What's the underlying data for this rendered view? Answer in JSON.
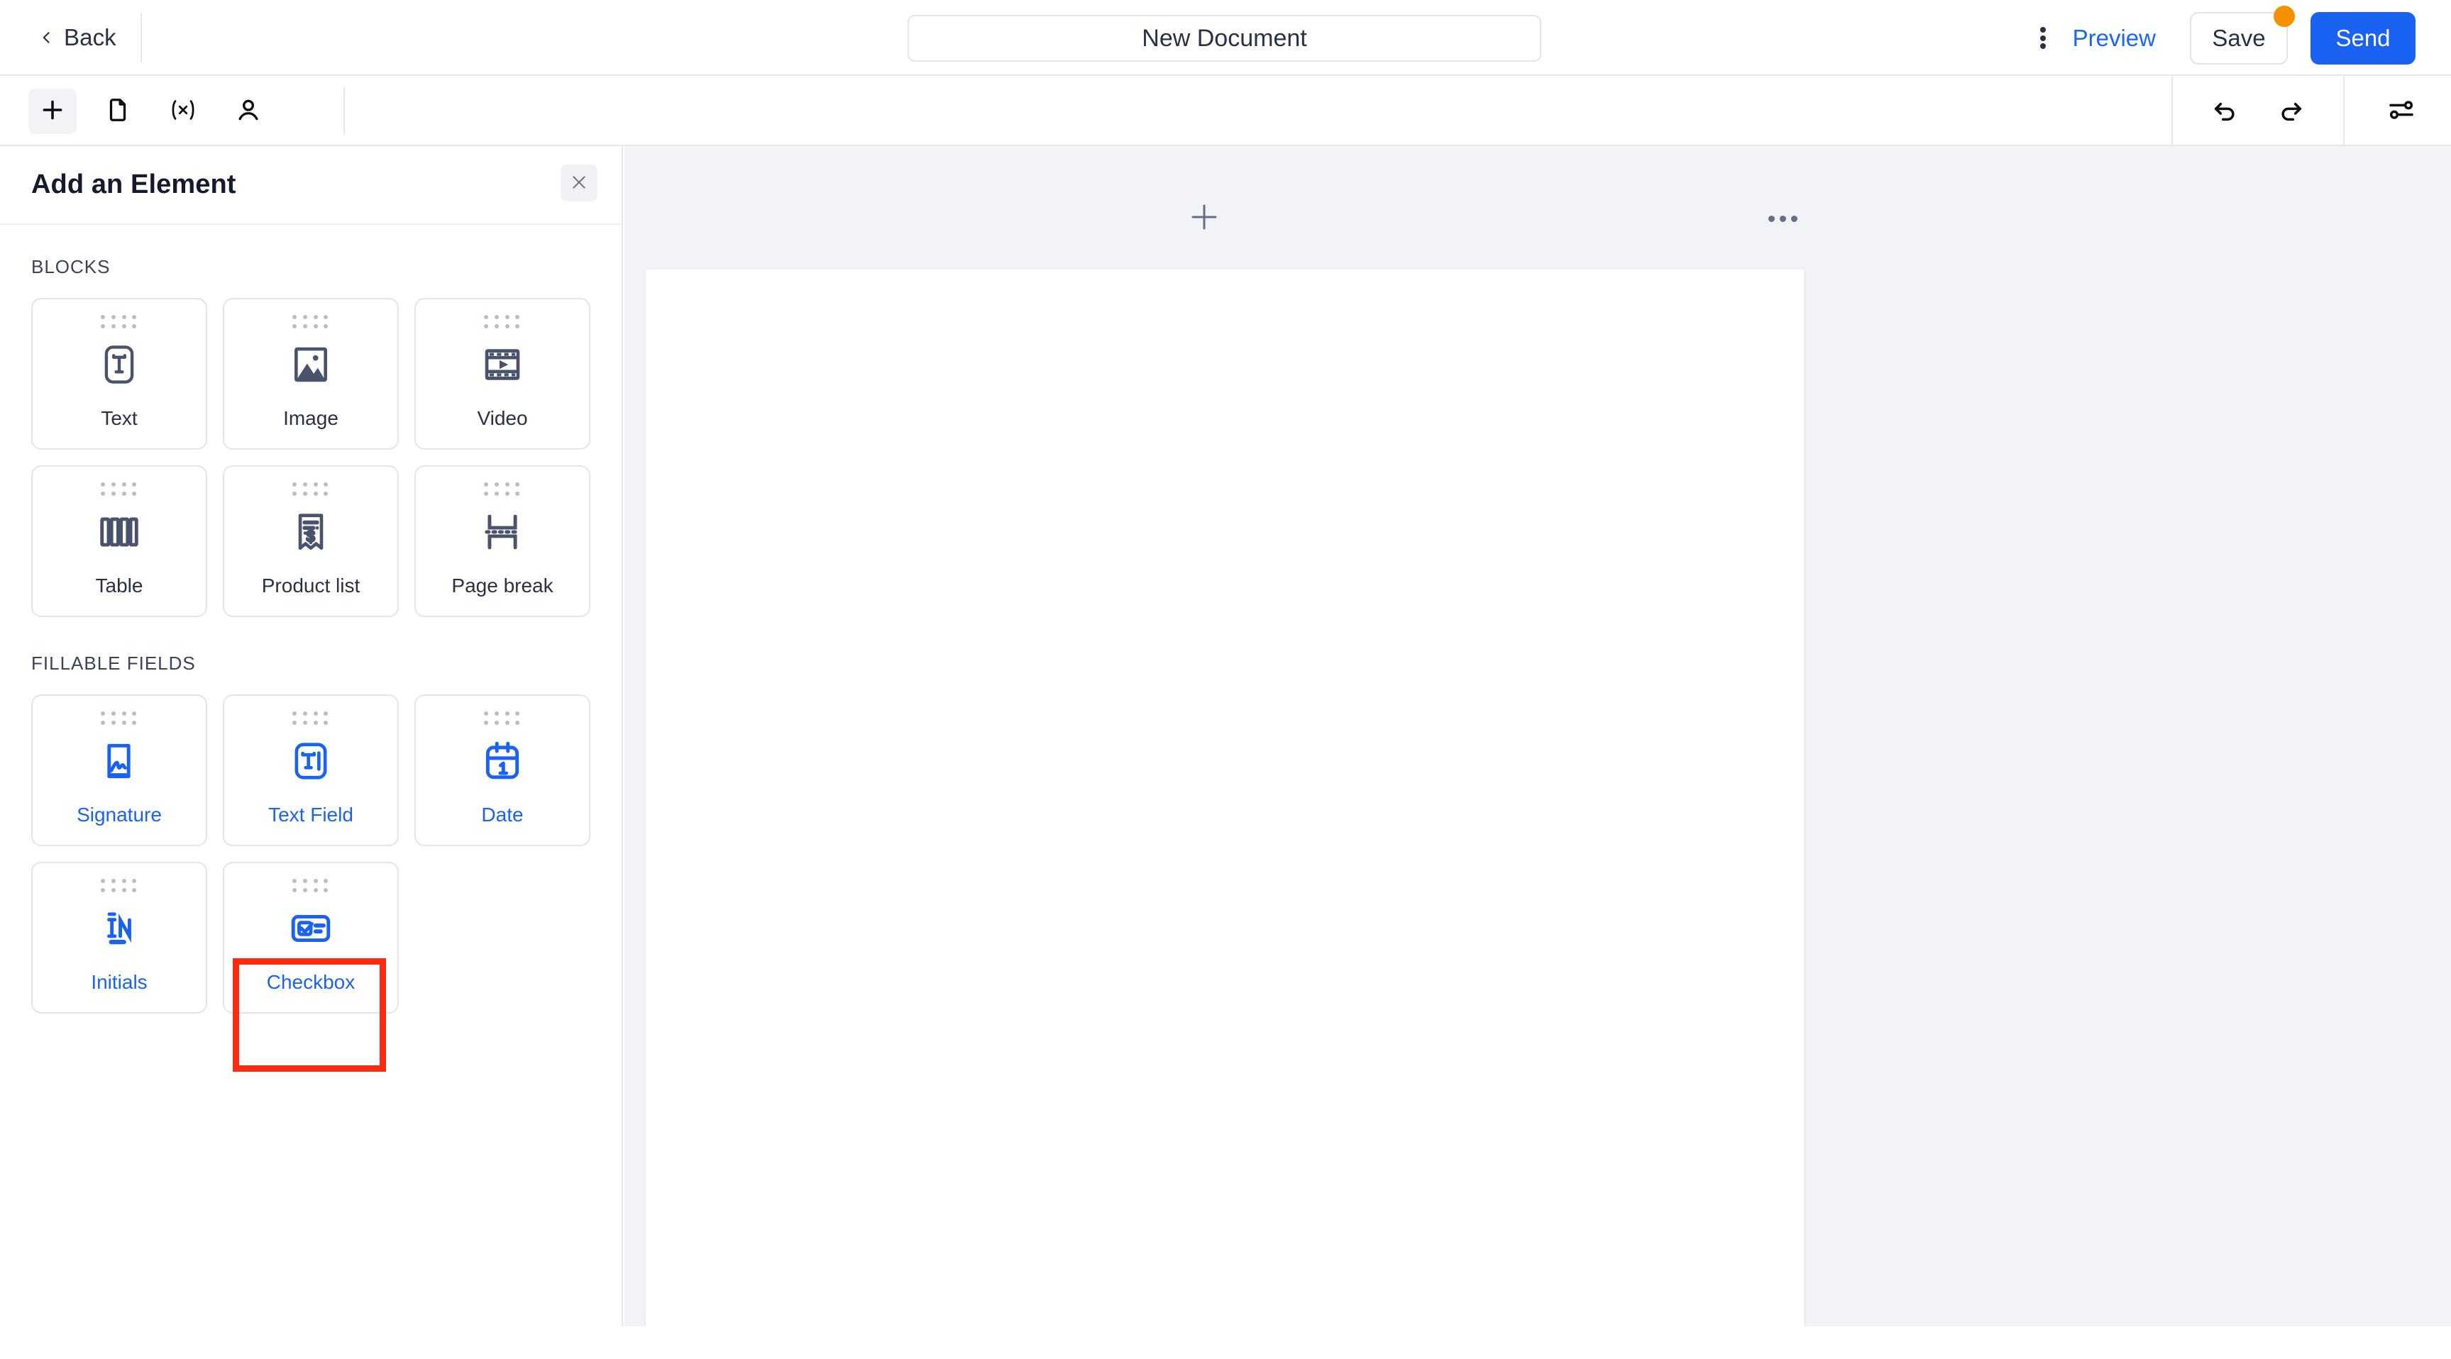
{
  "header": {
    "back_label": "Back",
    "back_icon": "chevron-left-icon",
    "document_title": "New Document",
    "document_title_placeholder": "Document name",
    "kebab_icon": "more-vertical-icon",
    "preview_label": "Preview",
    "save_label": "Save",
    "save_badge_color": "#f59100",
    "send_label": "Send",
    "send_color": "#1a63f2"
  },
  "toolbar": {
    "left_tools": [
      {
        "name": "add-element-tool",
        "icon": "plus-icon",
        "active": true
      },
      {
        "name": "pages-tool",
        "icon": "document-icon",
        "active": false
      },
      {
        "name": "variables-tool",
        "icon": "variable-xc-icon",
        "active": false
      },
      {
        "name": "recipients-tool",
        "icon": "person-icon",
        "active": false
      }
    ],
    "right_tools": [
      {
        "name": "undo-tool",
        "icon": "undo-arrow-icon"
      },
      {
        "name": "redo-tool",
        "icon": "redo-arrow-icon"
      },
      {
        "name": "settings-tool",
        "icon": "sliders-icon"
      }
    ]
  },
  "sidebar": {
    "title": "Add an Element",
    "close_icon": "close-x-icon",
    "sections": [
      {
        "label": "BLOCKS",
        "accent": "#2a3045",
        "items": [
          {
            "label": "Text",
            "icon": "text-box-icon"
          },
          {
            "label": "Image",
            "icon": "image-icon"
          },
          {
            "label": "Video",
            "icon": "video-film-icon"
          },
          {
            "label": "Table",
            "icon": "table-columns-icon"
          },
          {
            "label": "Product list",
            "icon": "receipt-dollar-icon"
          },
          {
            "label": "Page break",
            "icon": "page-break-icon"
          }
        ]
      },
      {
        "label": "FILLABLE FIELDS",
        "accent": "#1a63f2",
        "items": [
          {
            "label": "Signature",
            "icon": "signature-icon"
          },
          {
            "label": "Text Field",
            "icon": "text-field-cursor-icon"
          },
          {
            "label": "Date",
            "icon": "calendar-date-icon"
          },
          {
            "label": "Initials",
            "icon": "initials-in-icon"
          },
          {
            "label": "Checkbox",
            "icon": "checkbox-list-icon"
          }
        ]
      }
    ],
    "highlight": {
      "target_label": "Checkbox",
      "color": "#fc2b12"
    }
  },
  "canvas": {
    "add_icon": "plus-icon",
    "more_icon": "more-horizontal-icon",
    "page_background": "#ffffff",
    "background": "#f1f3f7"
  }
}
